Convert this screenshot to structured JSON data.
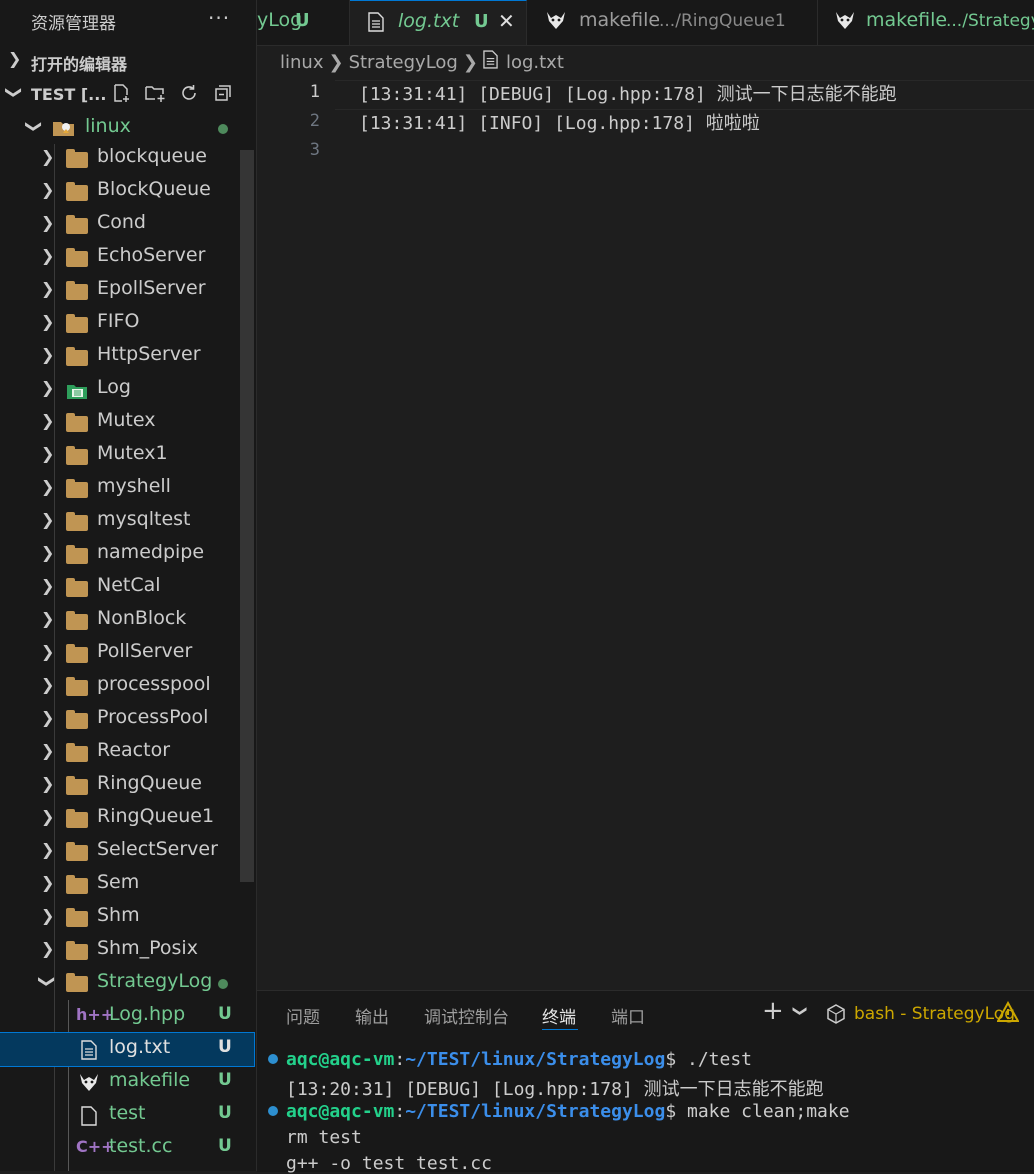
{
  "sidebar": {
    "title": "资源管理器",
    "more": "···",
    "open_editors": "打开的编辑器",
    "workspace": "TEST [..."
  },
  "tree": {
    "root": {
      "label": "linux"
    },
    "folders": [
      "blockqueue",
      "BlockQueue",
      "Cond",
      "EchoServer",
      "EpollServer",
      "FIFO",
      "HttpServer",
      "Log",
      "Mutex",
      "Mutex1",
      "myshell",
      "mysqltest",
      "namedpipe",
      "NetCal",
      "NonBlock",
      "PollServer",
      "processpool",
      "ProcessPool",
      "Reactor",
      "RingQueue",
      "RingQueue1",
      "SelectServer",
      "Sem",
      "Shm",
      "Shm_Posix"
    ],
    "open_folder": {
      "label": "StrategyLog"
    },
    "files": [
      {
        "label": "Log.hpp",
        "badge": "U",
        "icon": "h++"
      },
      {
        "label": "log.txt",
        "badge": "U",
        "icon": "text-file-icon"
      },
      {
        "label": "makefile",
        "badge": "U",
        "icon": "gnu-icon"
      },
      {
        "label": "test",
        "badge": "U",
        "icon": "file-icon"
      },
      {
        "label": "test.cc",
        "badge": "U",
        "icon": "C++"
      }
    ]
  },
  "tabs": [
    {
      "name": "yLog",
      "badge": "U"
    },
    {
      "name": "log.txt",
      "badge": "U",
      "close": "✕"
    },
    {
      "name": "makefile",
      "desc": ".../RingQueue1"
    },
    {
      "name": "makefile",
      "desc": ".../StrategyL"
    }
  ],
  "breadcrumb": [
    "linux",
    "StrategyLog",
    "log.txt"
  ],
  "editor": {
    "lines": [
      {
        "num": "1",
        "text": "[13:31:41] [DEBUG] [Log.hpp:178] 测试一下日志能不能跑"
      },
      {
        "num": "2",
        "text": "[13:31:41] [INFO] [Log.hpp:178] 啦啦啦"
      },
      {
        "num": "3",
        "text": ""
      }
    ]
  },
  "panel": {
    "tabs": [
      "问题",
      "输出",
      "调试控制台",
      "终端",
      "端口"
    ],
    "add": "+",
    "terminal_name": "bash - StrategyLog",
    "terminal": {
      "user": "aqc@aqc-vm",
      "path": "~/TEST/linux/StrategyLog",
      "cmd1": "$ ./test",
      "out1": "[13:20:31] [DEBUG] [Log.hpp:178] 测试一下日志能不能跑",
      "cmd2": "$ make clean;make",
      "out2": "rm test",
      "out3": "g++ -o test test.cc"
    }
  },
  "colors": {
    "accent": "#0078d4",
    "untracked": "#73c991",
    "folder": "#c09553"
  }
}
